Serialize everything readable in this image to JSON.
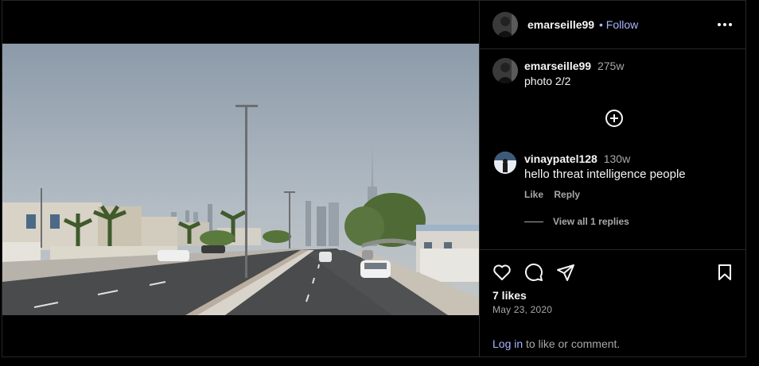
{
  "post": {
    "username": "emarseille99",
    "follow_label": "Follow",
    "separator": "•",
    "caption": {
      "username": "emarseille99",
      "time": "275w",
      "text": "photo 2/2"
    },
    "comments": [
      {
        "username": "vinaypatel128",
        "time": "130w",
        "text": "hello threat intelligence people",
        "like_label": "Like",
        "reply_label": "Reply",
        "view_replies": "View all 1 replies"
      }
    ],
    "likes": "7 likes",
    "date": "May 23, 2020",
    "login_link": "Log in",
    "login_suffix": " to like or comment."
  },
  "icons": {
    "more": "more-options-icon",
    "add_comments": "plus-circle-icon",
    "like": "heart-icon",
    "comment": "comment-icon",
    "share": "paper-plane-icon",
    "save": "bookmark-icon"
  },
  "colors": {
    "background": "#000000",
    "link": "#a8b5ff",
    "muted": "#a8a8a8",
    "border": "#262626"
  }
}
